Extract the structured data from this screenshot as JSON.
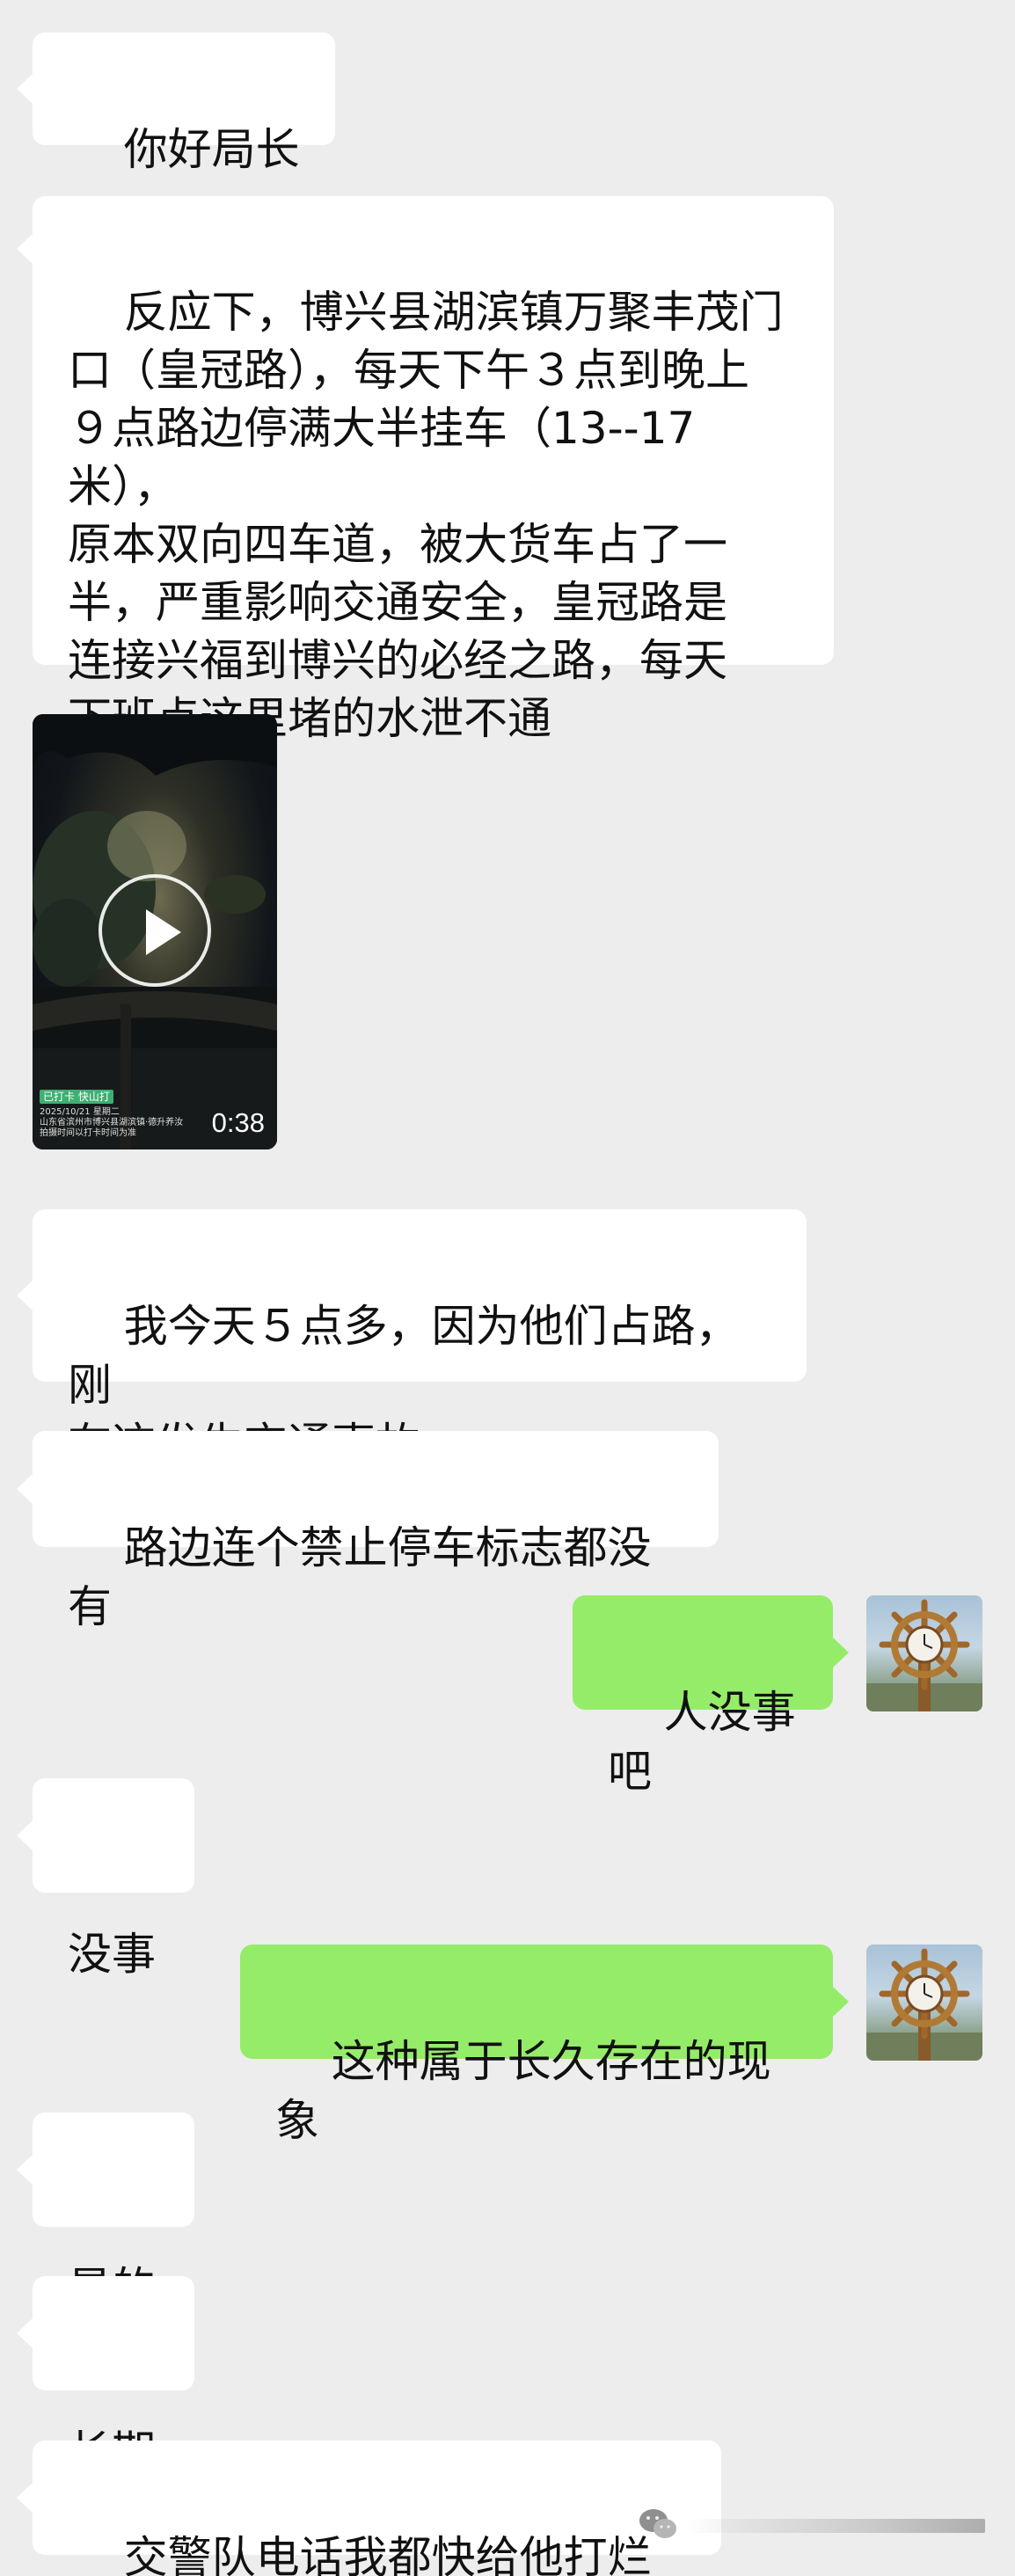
{
  "messages": [
    {
      "side": "in",
      "text": "你好局长"
    },
    {
      "side": "in",
      "text": "反应下，博兴县湖滨镇万聚丰茂门\n口（皇冠路），每天下午３点到晚上\n９点路边停满大半挂车（13--17米），\n原本双向四车道，被大货车占了一\n半，严重影响交通安全，皇冠路是\n连接兴福到博兴的必经之路，每天\n下班点这里堵的水泄不通"
    },
    {
      "side": "in",
      "type": "video",
      "duration": "0:38",
      "badge": "已打卡 快山打",
      "meta_date": "2025/10/21 星期二",
      "meta_location": "山东省滨州市博兴县湖滨镇·德升养汝",
      "meta_note": "拍摄时间以打卡时间为准"
    },
    {
      "side": "in",
      "text": "我今天５点多，因为他们占路，刚\n在这发生交通事故"
    },
    {
      "side": "in",
      "text": "路边连个禁止停车标志都没有"
    },
    {
      "side": "out",
      "text": "人没事吧",
      "avatar": "ship-wheel-clock-icon"
    },
    {
      "side": "in",
      "text": "没事"
    },
    {
      "side": "out",
      "text": "这种属于长久存在的现象",
      "avatar": "ship-wheel-clock-icon"
    },
    {
      "side": "in",
      "text": "是的"
    },
    {
      "side": "in",
      "text": "长期"
    },
    {
      "side": "in",
      "text": "交警队电话我都快给他打烂了"
    }
  ],
  "colors": {
    "background": "#ededed",
    "incoming_bubble": "#ffffff",
    "outgoing_bubble": "#95ec69"
  },
  "watermark": {
    "icon": "wechat-icon"
  }
}
